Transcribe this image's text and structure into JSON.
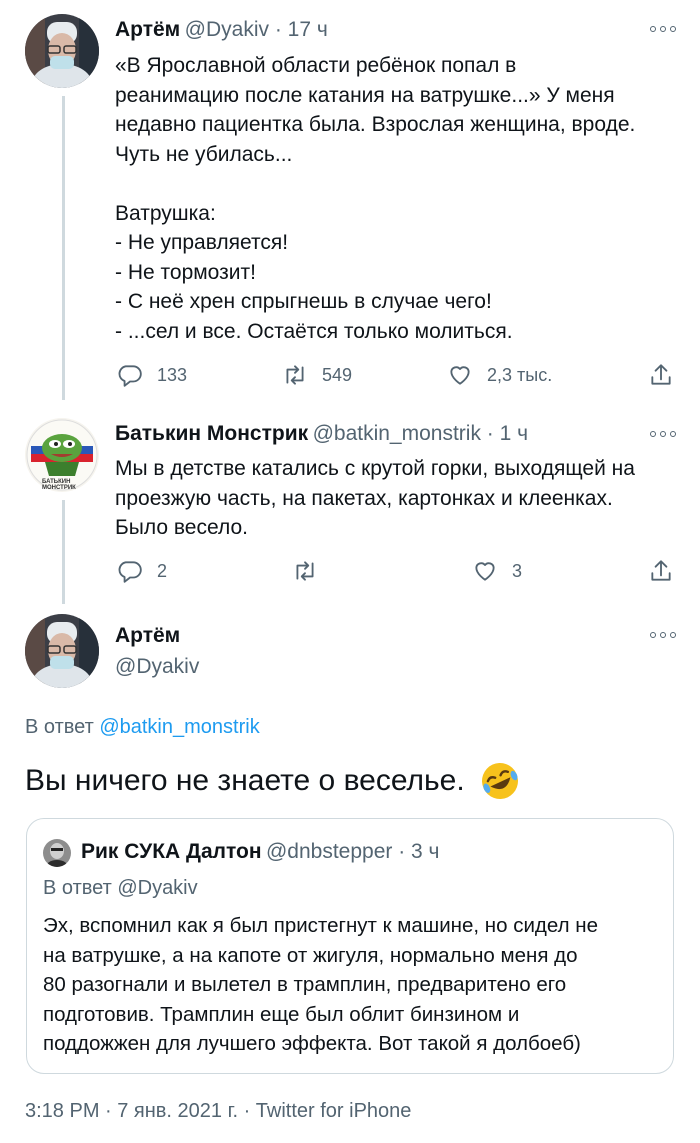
{
  "tweet1": {
    "name": "Артём",
    "handle": "@Dyakiv · 17 ч",
    "text": "«В Ярославной области ребёнок попал в\nреанимацию после катания на ватрушке...» У меня\nнедавно пациентка была. Взрослая женщина, вроде.\nЧуть не убилась...\n\nВатрушка:\n- Не управляется!\n- Не тормозит!\n- С неё хрен спрыгнешь в случае чего!\n- ...сел и все. Остаётся только молиться.",
    "replies": "133",
    "retweets": "549",
    "likes": "2,3 тыс."
  },
  "tweet2": {
    "name": "Батькин Монстрик",
    "handle": "@batkin_monstrik · 1 ч",
    "text": "Мы в детстве катались с крутой горки, выходящей на\nпроезжую часть, на пакетах, картонках и клеенках.\nБыло весело.",
    "replies": "2",
    "likes": "3",
    "avatar_caption": "БАТЬКИН\nМОНСТРИК"
  },
  "main": {
    "name": "Артём",
    "handle": "@Dyakiv",
    "reply_prefix": "В ответ ",
    "reply_to": "@batkin_monstrik",
    "text": "Вы ничего не знаете о веселье. ",
    "emoji": "🤣",
    "meta": "3:18 PM · 7 янв. 2021 г. · Twitter for iPhone"
  },
  "quote": {
    "name": "Рик СУКА Далтон",
    "handle": "@dnbstepper · 3 ч",
    "reply_line": "В ответ @Dyakiv",
    "text": "Эх, вспомнил как я был пристегнут к машине, но сидел не\nна ватрушке, а на капоте от жигуля, нормально меня до\n80 разогнали и вылетел в трамплин, предваритено его\nподготовив. Трамплин еще был облит бинзином и\nподдожжен для лучшего эффекта. Вот такой я долбоеб)"
  },
  "colors": {
    "link": "#1d9bf0",
    "muted": "#536471",
    "line": "#cfd9de"
  }
}
